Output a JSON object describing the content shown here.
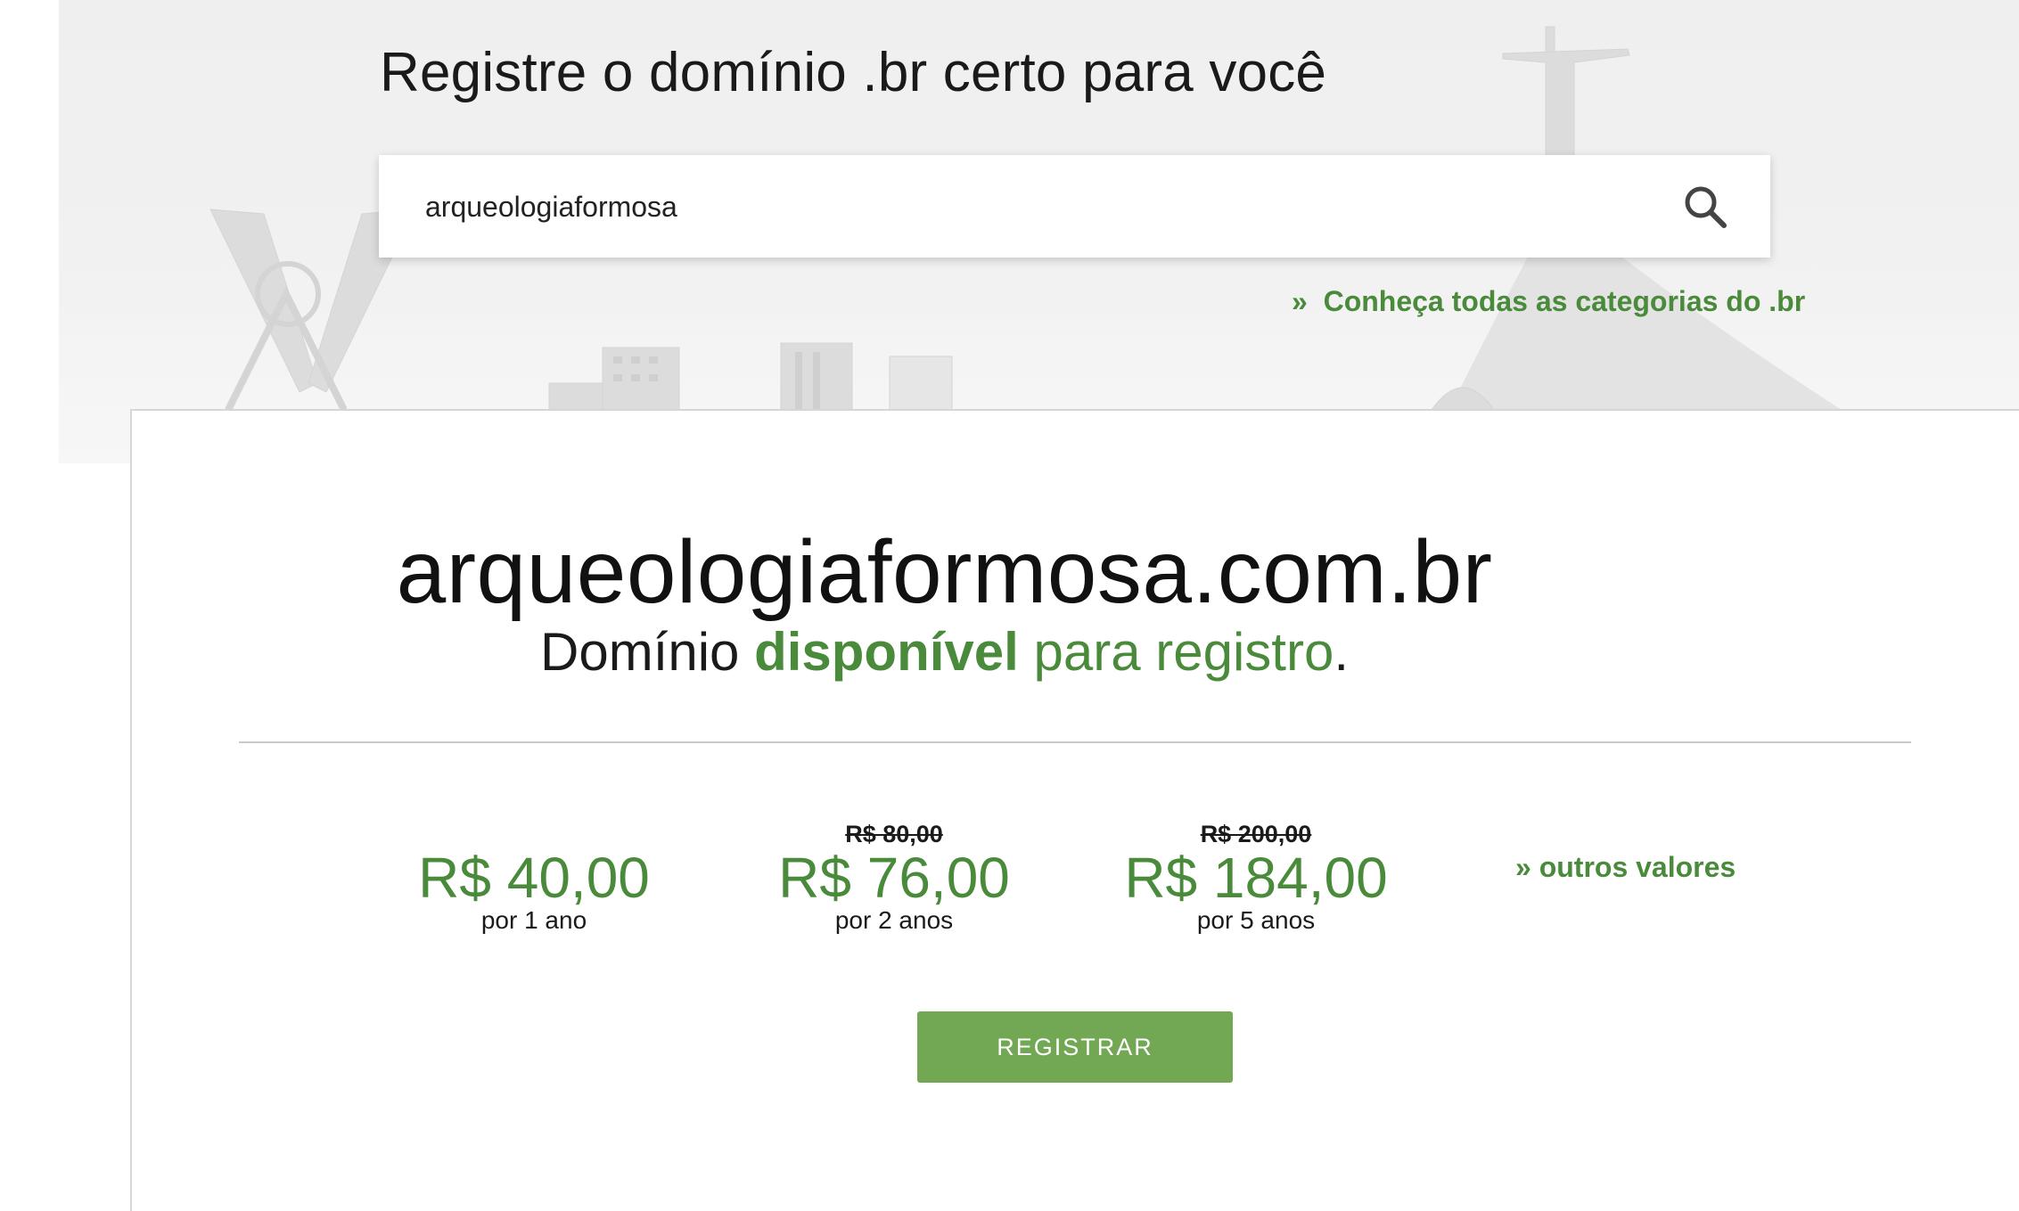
{
  "header": {
    "title": "Registre o domínio .br certo para você"
  },
  "search": {
    "value": "arqueologiaformosa",
    "icon": "search-icon"
  },
  "categories_link": {
    "arrow": "»",
    "label": "Conheça todas as categorias do .br"
  },
  "result": {
    "domain": "arqueologiaformosa.com.br",
    "status_prefix": "Domínio",
    "status_word": "disponível",
    "status_suffix": "para registro",
    "status_period": "."
  },
  "prices": [
    {
      "old_price": "",
      "price": "R$ 40,00",
      "period": "por 1 ano"
    },
    {
      "old_price": "R$ 80,00",
      "price": "R$ 76,00",
      "period": "por 2 anos"
    },
    {
      "old_price": "R$ 200,00",
      "price": "R$ 184,00",
      "period": "por 5 anos"
    }
  ],
  "other_values_link": "» outros valores",
  "register_button": "REGISTRAR",
  "colors": {
    "accent_green": "#4a8a3b",
    "button_green": "#72a853",
    "background": "#efefef"
  }
}
